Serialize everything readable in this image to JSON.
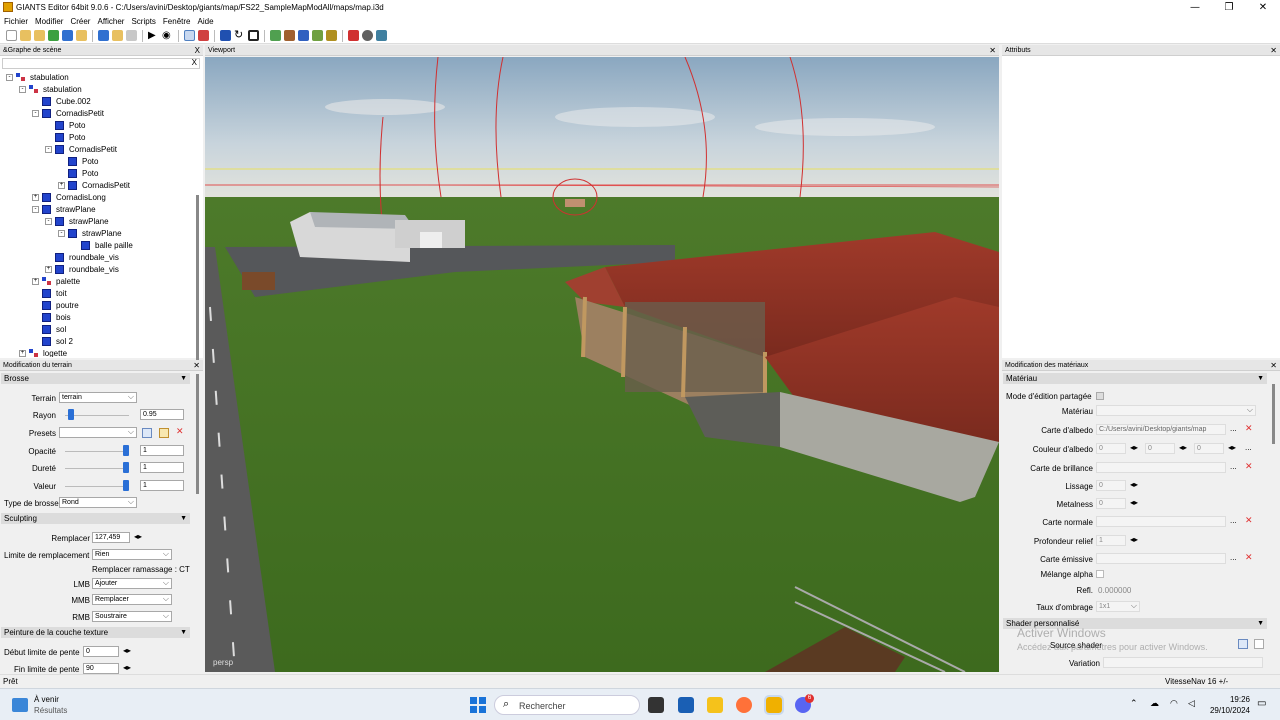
{
  "window": {
    "title": "GIANTS Editor 64bit 9.0.6 - C:/Users/avini/Desktop/giants/map/FS22_SampleMapModAll/maps/map.i3d",
    "minimize": "—",
    "maximize": "❐",
    "close": "✕"
  },
  "menu": [
    "Fichier",
    "Modifier",
    "Créer",
    "Afficher",
    "Scripts",
    "Fenêtre",
    "Aide"
  ],
  "toolbar_icons": [
    "new-icon",
    "open-icon",
    "save-icon",
    "refresh-icon",
    "export-icon",
    "import-icon",
    "undo-icon",
    "redo-icon",
    "play-icon",
    "eye-icon",
    "select-icon",
    "brush-icon",
    "move-icon",
    "rotate-icon",
    "scale-icon",
    "terrain-icon",
    "paint-icon",
    "foliage-icon",
    "decal-icon",
    "tree-icon",
    "color-icon",
    "settings-icon",
    "script-icon"
  ],
  "scene_graph": {
    "title": "&Graphe de scène",
    "close": "X",
    "filter_clear": "X",
    "items": [
      {
        "label": "stabulation",
        "depth": 0,
        "type": "group",
        "exp": "-"
      },
      {
        "label": "stabulation",
        "depth": 1,
        "type": "group",
        "exp": "-"
      },
      {
        "label": "Cube.002",
        "depth": 2,
        "type": "cube",
        "exp": ""
      },
      {
        "label": "CornadisPetit",
        "depth": 2,
        "type": "cube",
        "exp": "-"
      },
      {
        "label": "Poto",
        "depth": 3,
        "type": "cube",
        "exp": ""
      },
      {
        "label": "Poto",
        "depth": 3,
        "type": "cube",
        "exp": ""
      },
      {
        "label": "CornadisPetit",
        "depth": 3,
        "type": "cube",
        "exp": "-"
      },
      {
        "label": "Poto",
        "depth": 4,
        "type": "cube",
        "exp": ""
      },
      {
        "label": "Poto",
        "depth": 4,
        "type": "cube",
        "exp": ""
      },
      {
        "label": "CornadisPetit",
        "depth": 4,
        "type": "cube",
        "exp": "+"
      },
      {
        "label": "CornadisLong",
        "depth": 2,
        "type": "cube",
        "exp": "+"
      },
      {
        "label": "strawPlane",
        "depth": 2,
        "type": "cube",
        "exp": "-"
      },
      {
        "label": "strawPlane",
        "depth": 3,
        "type": "cube",
        "exp": "-"
      },
      {
        "label": "strawPlane",
        "depth": 4,
        "type": "cube",
        "exp": "-"
      },
      {
        "label": "balle paille",
        "depth": 5,
        "type": "cube",
        "exp": ""
      },
      {
        "label": "roundbale_vis",
        "depth": 3,
        "type": "cube",
        "exp": ""
      },
      {
        "label": "roundbale_vis",
        "depth": 3,
        "type": "cube",
        "exp": "+"
      },
      {
        "label": "palette",
        "depth": 2,
        "type": "group",
        "exp": "+"
      },
      {
        "label": "toit",
        "depth": 2,
        "type": "cube",
        "exp": ""
      },
      {
        "label": "poutre",
        "depth": 2,
        "type": "cube",
        "exp": ""
      },
      {
        "label": "bois",
        "depth": 2,
        "type": "cube",
        "exp": ""
      },
      {
        "label": "sol",
        "depth": 2,
        "type": "cube",
        "exp": ""
      },
      {
        "label": "sol 2",
        "depth": 2,
        "type": "cube",
        "exp": ""
      },
      {
        "label": "logette",
        "depth": 1,
        "type": "group",
        "exp": "+"
      }
    ]
  },
  "terrain": {
    "title": "Modification du terrain",
    "close": "✕",
    "brush_section": "Brosse",
    "terrain_label": "Terrain",
    "terrain_value": "terrain",
    "rayon_label": "Rayon",
    "rayon_value": "0.95",
    "rayon_level": 0.05,
    "presets_label": "Presets",
    "opacite_label": "Opacité",
    "opacite_value": "1",
    "opacite_level": 1,
    "durete_label": "Dureté",
    "durete_value": "1",
    "durete_level": 1,
    "valeur_label": "Valeur",
    "valeur_value": "1",
    "valeur_level": 1,
    "type_label": "Type de brosse",
    "type_value": "Rond",
    "sculpt_section": "Sculpting",
    "remplacer_label": "Remplacer",
    "remplacer_value": "127,459",
    "limite_label": "Limite de remplacement",
    "limite_value": "Rien",
    "ramassage_text": "Remplacer ramassage : CT",
    "lmb_label": "LMB",
    "lmb_value": "Ajouter",
    "mmb_label": "MMB",
    "mmb_value": "Remplacer",
    "rmb_label": "RMB",
    "rmb_value": "Soustraire",
    "paint_section": "Peinture de la couche texture",
    "debut_label": "Début limite de pente",
    "debut_value": "0",
    "fin_label": "Fin limite de pente",
    "fin_value": "90"
  },
  "viewport": {
    "title": "Viewport",
    "close": "✕",
    "camera_label": "persp"
  },
  "attributes": {
    "title": "Attributs",
    "close": "✕"
  },
  "materials": {
    "title": "Modification des matériaux",
    "close": "✕",
    "section": "Matériau",
    "shared_label": "Mode d'édition partagée",
    "material_label": "Matériau",
    "albedo_map_label": "Carte d'albedo",
    "albedo_map_value": "C:/Users/avini/Desktop/giants/map",
    "albedo_color_label": "Couleur d'albedo",
    "albedo_r": "0",
    "albedo_g": "0",
    "albedo_b": "0",
    "gloss_label": "Carte de brillance",
    "lissage_label": "Lissage",
    "lissage_value": "0",
    "metal_label": "Metalness",
    "metal_value": "0",
    "normal_label": "Carte normale",
    "relief_label": "Profondeur relief",
    "relief_value": "1",
    "emissive_label": "Carte émissive",
    "alpha_label": "Mélange alpha",
    "refl_label": "Refl.",
    "refl_value": "0.000000",
    "shadow_label": "Taux d'ombrage",
    "shadow_value": "1x1",
    "shader_section": "Shader personnalisé",
    "shader_source_label": "Source shader",
    "variation_label": "Variation",
    "dots": "...",
    "remove": "✕"
  },
  "watermark": {
    "line1": "Activer Windows",
    "line2": "Accédez aux paramètres pour activer Windows."
  },
  "status": {
    "left": "Prêt",
    "right": "VitesseNav 16 +/-"
  },
  "taskbar": {
    "weather_title": "À venir",
    "weather_sub": "Résultats",
    "search_placeholder": "Rechercher",
    "time": "19:26",
    "date": "29/10/2024",
    "badge": "6"
  },
  "colors": {
    "accent": "#2a6fd6",
    "cube": "#2244cc",
    "remove": "#e03030"
  }
}
